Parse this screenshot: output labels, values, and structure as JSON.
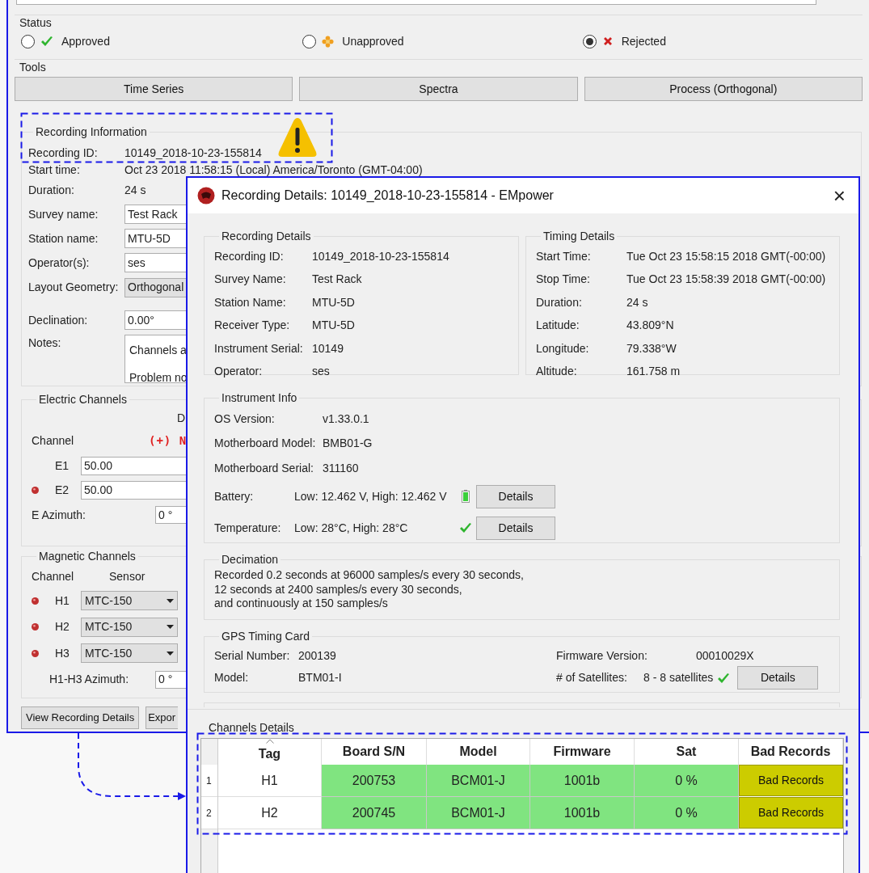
{
  "main_window": {
    "status": {
      "title": "Status",
      "options": [
        {
          "kind": "approved",
          "label": "Approved",
          "selected": false
        },
        {
          "kind": "unapproved",
          "label": "Unapproved",
          "selected": false
        },
        {
          "kind": "rejected",
          "label": "Rejected",
          "selected": true
        }
      ]
    },
    "tools": {
      "title": "Tools",
      "buttons": [
        "Time Series",
        "Spectra",
        "Process (Orthogonal)"
      ]
    },
    "recording_information": {
      "title": "Recording Information",
      "fields": [
        {
          "kind": "text",
          "label": "Recording ID:",
          "value": "10149_2018-10-23-155814"
        },
        {
          "kind": "text",
          "label": "Start time:",
          "value": "Oct 23 2018 11:58:15 (Local) America/Toronto (GMT-04:00)"
        },
        {
          "kind": "text",
          "label": "Duration:",
          "value": "24 s"
        },
        {
          "kind": "input",
          "label": "Survey name:",
          "value": "Test Rack"
        },
        {
          "kind": "input",
          "label": "Station name:",
          "value": "MTU-5D"
        },
        {
          "kind": "input",
          "label": "Operator(s):",
          "value": "ses"
        },
        {
          "kind": "dropdown",
          "label": "Layout Geometry:",
          "value": "Orthogonal"
        },
        {
          "kind": "input",
          "label": "Declination:",
          "value": "0.00°"
        },
        {
          "kind": "textarea",
          "label": "Notes:",
          "lines": [
            "Channels a",
            "Problem no"
          ]
        }
      ]
    },
    "electric_channels": {
      "title": "Electric Channels",
      "column_2": "D",
      "channel_header": "Channel",
      "polarity": "(+) N",
      "rows": [
        {
          "label": "E1",
          "warning": false,
          "value": "50.00"
        },
        {
          "label": "E2",
          "warning": true,
          "value": "50.00"
        }
      ],
      "azimuth": {
        "label": "E Azimuth:",
        "value": "0 °"
      }
    },
    "magnetic_channels": {
      "title": "Magnetic Channels",
      "channel_header": "Channel",
      "sensor_header": "Sensor",
      "rows": [
        {
          "label": "H1",
          "warning": true,
          "value": "MTC-150"
        },
        {
          "label": "H2",
          "warning": true,
          "value": "MTC-150"
        },
        {
          "label": "H3",
          "warning": true,
          "value": "MTC-150"
        }
      ],
      "azimuth": {
        "label": "H1-H3 Azimuth:",
        "value": "0 °"
      }
    },
    "buttons": [
      "View Recording Details",
      "Expor"
    ]
  },
  "dialog": {
    "title": "Recording Details: 10149_2018-10-23-155814 - EMpower",
    "close": "×",
    "recording_details": {
      "title": "Recording Details",
      "rows": [
        {
          "label": "Recording ID:",
          "value": "10149_2018-10-23-155814"
        },
        {
          "label": "Survey Name:",
          "value": "Test Rack"
        },
        {
          "label": "Station Name:",
          "value": "MTU-5D"
        },
        {
          "label": "Receiver Type:",
          "value": "MTU-5D"
        },
        {
          "label": "Instrument Serial:",
          "value": "10149"
        },
        {
          "label": "Operator:",
          "value": "ses"
        }
      ]
    },
    "timing_details": {
      "title": "Timing Details",
      "rows": [
        {
          "label": "Start Time:",
          "value": "Tue Oct 23 15:58:15 2018 GMT(-00:00)"
        },
        {
          "label": "Stop Time:",
          "value": "Tue Oct 23 15:58:39 2018 GMT(-00:00)"
        },
        {
          "label": "Duration:",
          "value": "24 s"
        },
        {
          "label": "Latitude:",
          "value": "43.809°N"
        },
        {
          "label": "Longitude:",
          "value": "79.338°W"
        },
        {
          "label": "Altitude:",
          "value": "161.758 m"
        }
      ]
    },
    "instrument_info": {
      "title": "Instrument Info",
      "rows": [
        {
          "label": "OS Version:",
          "value": "v1.33.0.1"
        },
        {
          "label": "Motherboard Model:",
          "value": "BMB01-G"
        },
        {
          "label": "Motherboard Serial:",
          "value": "311160"
        }
      ],
      "checks": [
        {
          "kind": "battery",
          "label": "Battery:",
          "value": "Low: 12.462 V, High: 12.462 V",
          "button": "Details"
        },
        {
          "kind": "ok",
          "label": "Temperature:",
          "value": "Low: 28°C, High: 28°C",
          "button": "Details"
        }
      ]
    },
    "decimation": {
      "title": "Decimation",
      "lines": [
        "Recorded 0.2 seconds at 96000 samples/s every 30 seconds,",
        "12 seconds at 2400 samples/s every 30 seconds,",
        "and continuously at 150 samples/s"
      ]
    },
    "gps_timing_card": {
      "title": "GPS Timing Card",
      "rows": [
        {
          "label": "Serial Number:",
          "value": "200139"
        },
        {
          "label": "Model:",
          "value": "BTM01-I"
        }
      ],
      "firmware": {
        "label": "Firmware Version:",
        "value": "00010029X"
      },
      "satellites": {
        "label": "# of Satellites:",
        "value": "8 - 8 satellites",
        "button": "Details"
      }
    },
    "channels_details": {
      "title": "Channels Details",
      "columns": [
        {
          "label": "Tag",
          "sorted": true
        },
        {
          "label": "Board S/N",
          "sorted": false
        },
        {
          "label": "Model",
          "sorted": false
        },
        {
          "label": "Firmware",
          "sorted": false
        },
        {
          "label": "Sat",
          "sorted": false
        },
        {
          "label": "Bad Records",
          "sorted": false
        }
      ],
      "rows": [
        {
          "index": "1",
          "cells": [
            "H1",
            "200753",
            "BCM01-J",
            "1001b",
            "0 %"
          ],
          "button": "Bad Records"
        },
        {
          "index": "2",
          "cells": [
            "H2",
            "200745",
            "BCM01-J",
            "1001b",
            "0 %"
          ],
          "button": "Bad Records"
        }
      ]
    }
  }
}
